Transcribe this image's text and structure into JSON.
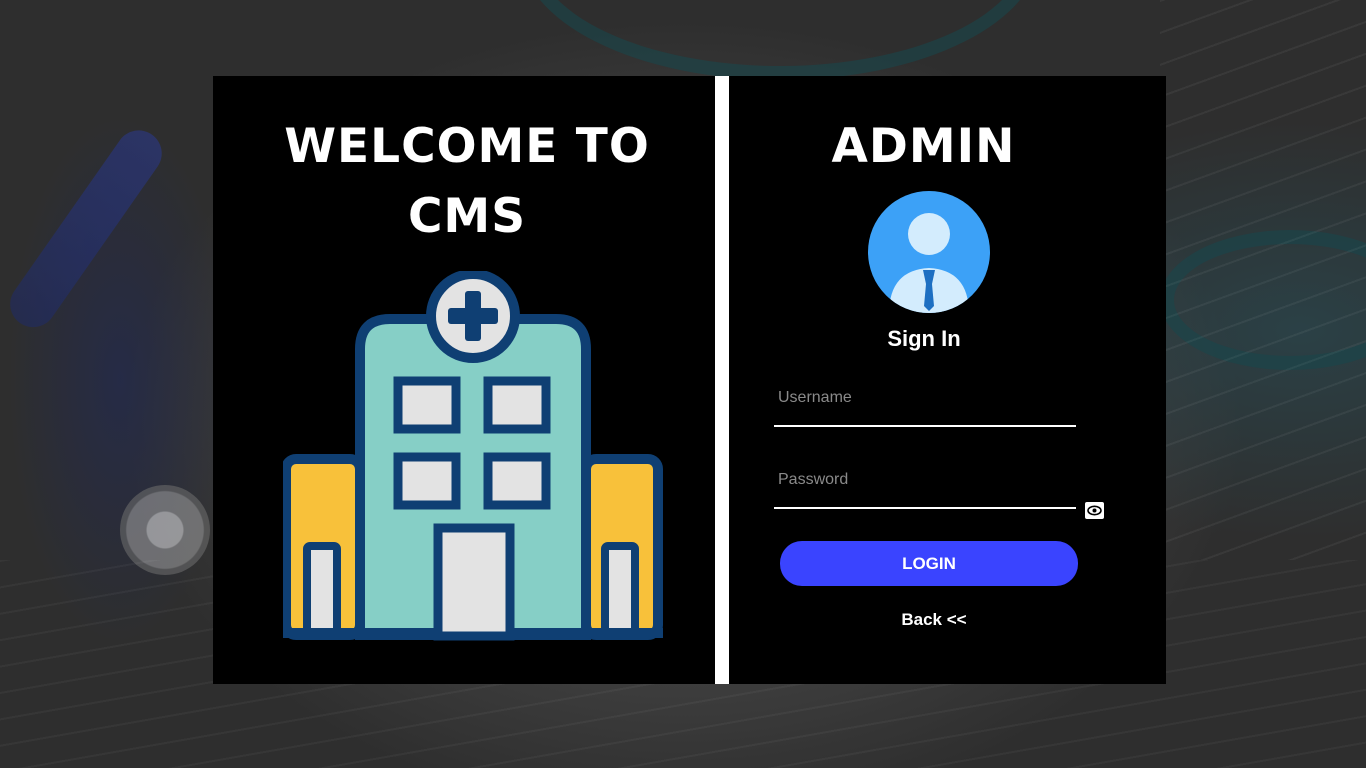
{
  "welcome": {
    "line1": "WELCOME TO",
    "line2": "CMS"
  },
  "admin": {
    "title": "ADMIN",
    "signin_label": "Sign In",
    "username_placeholder": "Username",
    "password_placeholder": "Password",
    "login_label": "LOGIN",
    "back_label": "Back <<"
  },
  "icons": {
    "hospital": "hospital-icon",
    "avatar": "user-avatar-icon",
    "password_toggle": "eye-icon"
  },
  "colors": {
    "panel": "#000000",
    "login_button": "#3a44ff",
    "avatar_circle": "#3ca1f7",
    "hospital_body": "#86cfc6",
    "hospital_wings": "#f8c13a",
    "hospital_outline": "#0f3f73"
  }
}
